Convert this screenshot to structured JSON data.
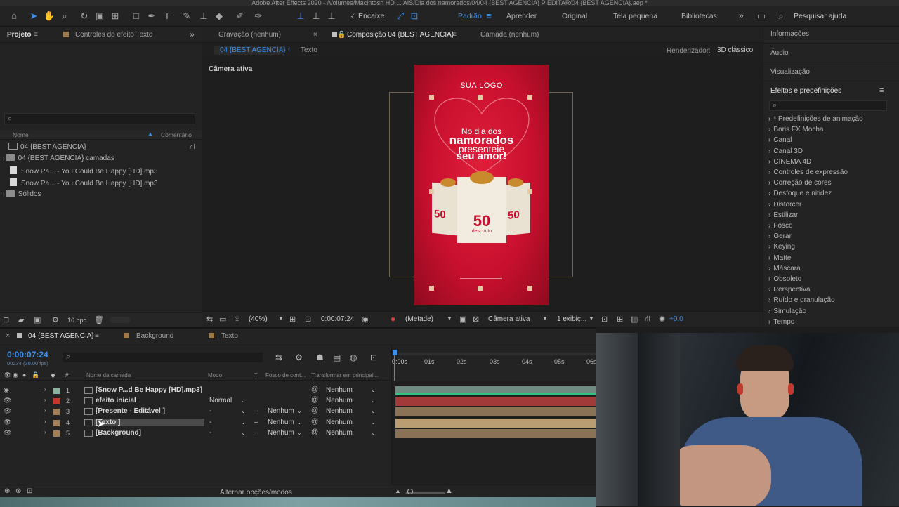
{
  "window": {
    "title": "Adobe After Effects 2020 - /Volumes/Macintosh HD ... AIS/Dia dos namorados/04/04 {BEST AGENCIA} P EDITAR/04 {BEST AGENCIA}.aep *"
  },
  "toolbar": {
    "snap_label": "Encaixe",
    "workspaces": [
      "Padrão",
      "Aprender",
      "Original",
      "Tela pequena",
      "Bibliotecas"
    ],
    "active_workspace": "Padrão",
    "search_help": "Pesquisar ajuda",
    "more": "»"
  },
  "project": {
    "tab_label": "Projeto",
    "effects_tab_label": "Controles do efeito Texto",
    "search_glyph": "⌕",
    "col_name": "Nome",
    "col_comment": "Comentário",
    "items": [
      {
        "label": "04 {BEST AGENCIA}",
        "icon": "composition-icon"
      },
      {
        "label": "04 {BEST AGENCIA} camadas",
        "icon": "folder-icon"
      },
      {
        "label": "Snow Pa... - You Could Be Happy [HD].mp3",
        "icon": "audio-file-icon"
      },
      {
        "label": "Snow Pa... - You Could Be Happy [HD].mp3",
        "icon": "audio-file-icon"
      },
      {
        "label": "Sólidos",
        "icon": "folder-icon"
      }
    ],
    "bpc": "16 bpc"
  },
  "viewer": {
    "tabs": [
      "Gravação (nenhum)",
      "Composição 04 {BEST AGENCIA}",
      "Camada (nenhum)"
    ],
    "breadcrumb": [
      "04 {BEST AGENCIA}",
      "Texto"
    ],
    "renderer_label": "Renderizador:",
    "renderer_value": "3D clássico",
    "active_camera_label": "Câmera ativa",
    "zoom": "(40%)",
    "timecode": "0:00:07:24",
    "resolution": "(Metade)",
    "camera": "Câmera ativa",
    "views": "1 exibiç...",
    "exposure": "+0,0"
  },
  "artwork": {
    "logo": "SUA LOGO",
    "line1": "No dia dos",
    "line2": "namorados",
    "line3": "presenteie",
    "line4": "seu amor!",
    "badge": "50",
    "badge_sub": "desconto",
    "colors": {
      "bg": "#c8102e",
      "bg_dark": "#8e0a1f",
      "gold": "#c98a2e"
    }
  },
  "effects_panel": {
    "sections": [
      "Informações",
      "Áudio",
      "Visualização"
    ],
    "title": "Efeitos e predefinições",
    "items": [
      "* Predefinições de animação",
      "Boris FX Mocha",
      "Canal",
      "Canal 3D",
      "CINEMA 4D",
      "Controles de expressão",
      "Correção de cores",
      "Desfoque e nitidez",
      "Distorcer",
      "Estilizar",
      "Fosco",
      "Gerar",
      "Keying",
      "Matte",
      "Máscara",
      "Obsoleto",
      "Perspectiva",
      "Ruído e granulação",
      "Simulação",
      "Tempo"
    ]
  },
  "timeline": {
    "tabs": [
      "04 {BEST AGENCIA}",
      "Background",
      "Texto"
    ],
    "timecode": "0:00:07:24",
    "frames": "00234 (30.00 fps)",
    "headers": {
      "name": "Nome da camada",
      "mode": "Modo",
      "t": "T",
      "matte": "Fosco de cont...",
      "parent": "Transformar em principal..."
    },
    "ruler": [
      "0:00s",
      "01s",
      "02s",
      "03s",
      "04s",
      "05s",
      "06s"
    ],
    "layers": [
      {
        "num": "1",
        "name": "[Snow P...d Be Happy [HD].mp3]",
        "mode": "",
        "matte": "",
        "parent": "Nenhum",
        "label_color": "#8fb0a0",
        "bar_color": "#6f8a80"
      },
      {
        "num": "2",
        "name": "efeito inicial",
        "mode": "Normal",
        "matte": "",
        "parent": "Nenhum",
        "label_color": "#c0392b",
        "bar_color": "#a33a3a"
      },
      {
        "num": "3",
        "name": "[Presente - Editável ]",
        "mode": "-",
        "matte": "Nenhum",
        "parent": "Nenhum",
        "label_color": "#a0805a",
        "bar_color": "#8a7256"
      },
      {
        "num": "4",
        "name": "[Texto ]",
        "mode": "-",
        "matte": "Nenhum",
        "parent": "Nenhum",
        "label_color": "#a0805a",
        "bar_color": "#b99d73"
      },
      {
        "num": "5",
        "name": "[Background]",
        "mode": "-",
        "matte": "Nenhum",
        "parent": "Nenhum",
        "label_color": "#a0805a",
        "bar_color": "#8a7256"
      }
    ],
    "footer": "Alternar opções/modos"
  }
}
